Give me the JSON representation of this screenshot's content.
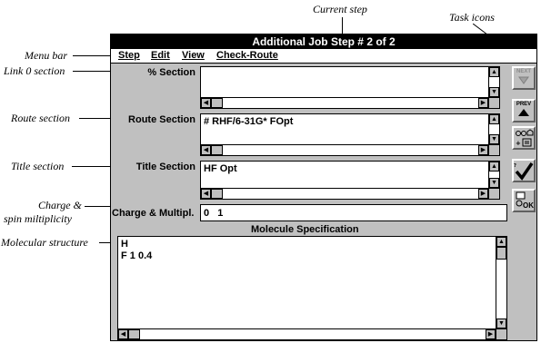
{
  "annotations": {
    "current_step": "Current step",
    "task_icons": "Task icons",
    "menu_bar": "Menu bar",
    "link0_section": "Link 0 section",
    "route_section": "Route section",
    "title_section": "Title section",
    "charge_line1": "Charge &",
    "charge_line2": "spin miltiplicity",
    "molecular_structure": "Molecular structure"
  },
  "window": {
    "title": "Additional Job Step # 2 of 2"
  },
  "menu": {
    "step": "Step",
    "edit": "Edit",
    "view": "View",
    "check_route": "Check-Route"
  },
  "sections": {
    "percent_label": "% Section",
    "percent_value": "",
    "route_label": "Route Section",
    "route_value": "# RHF/6-31G* FOpt",
    "title_label": "Title Section",
    "title_value": "HF Opt",
    "charge_label": "Charge & Multipl.",
    "charge_value": "0   1",
    "molecule_header": "Molecule Specification",
    "molecule_lines": [
      "H",
      "F 1 0.4"
    ]
  },
  "task_buttons": {
    "next": "NEXT",
    "prev": "PREV",
    "ok": "OK"
  },
  "colors": {
    "window_bg": "#c0c0c0",
    "titlebar": "#000000"
  }
}
